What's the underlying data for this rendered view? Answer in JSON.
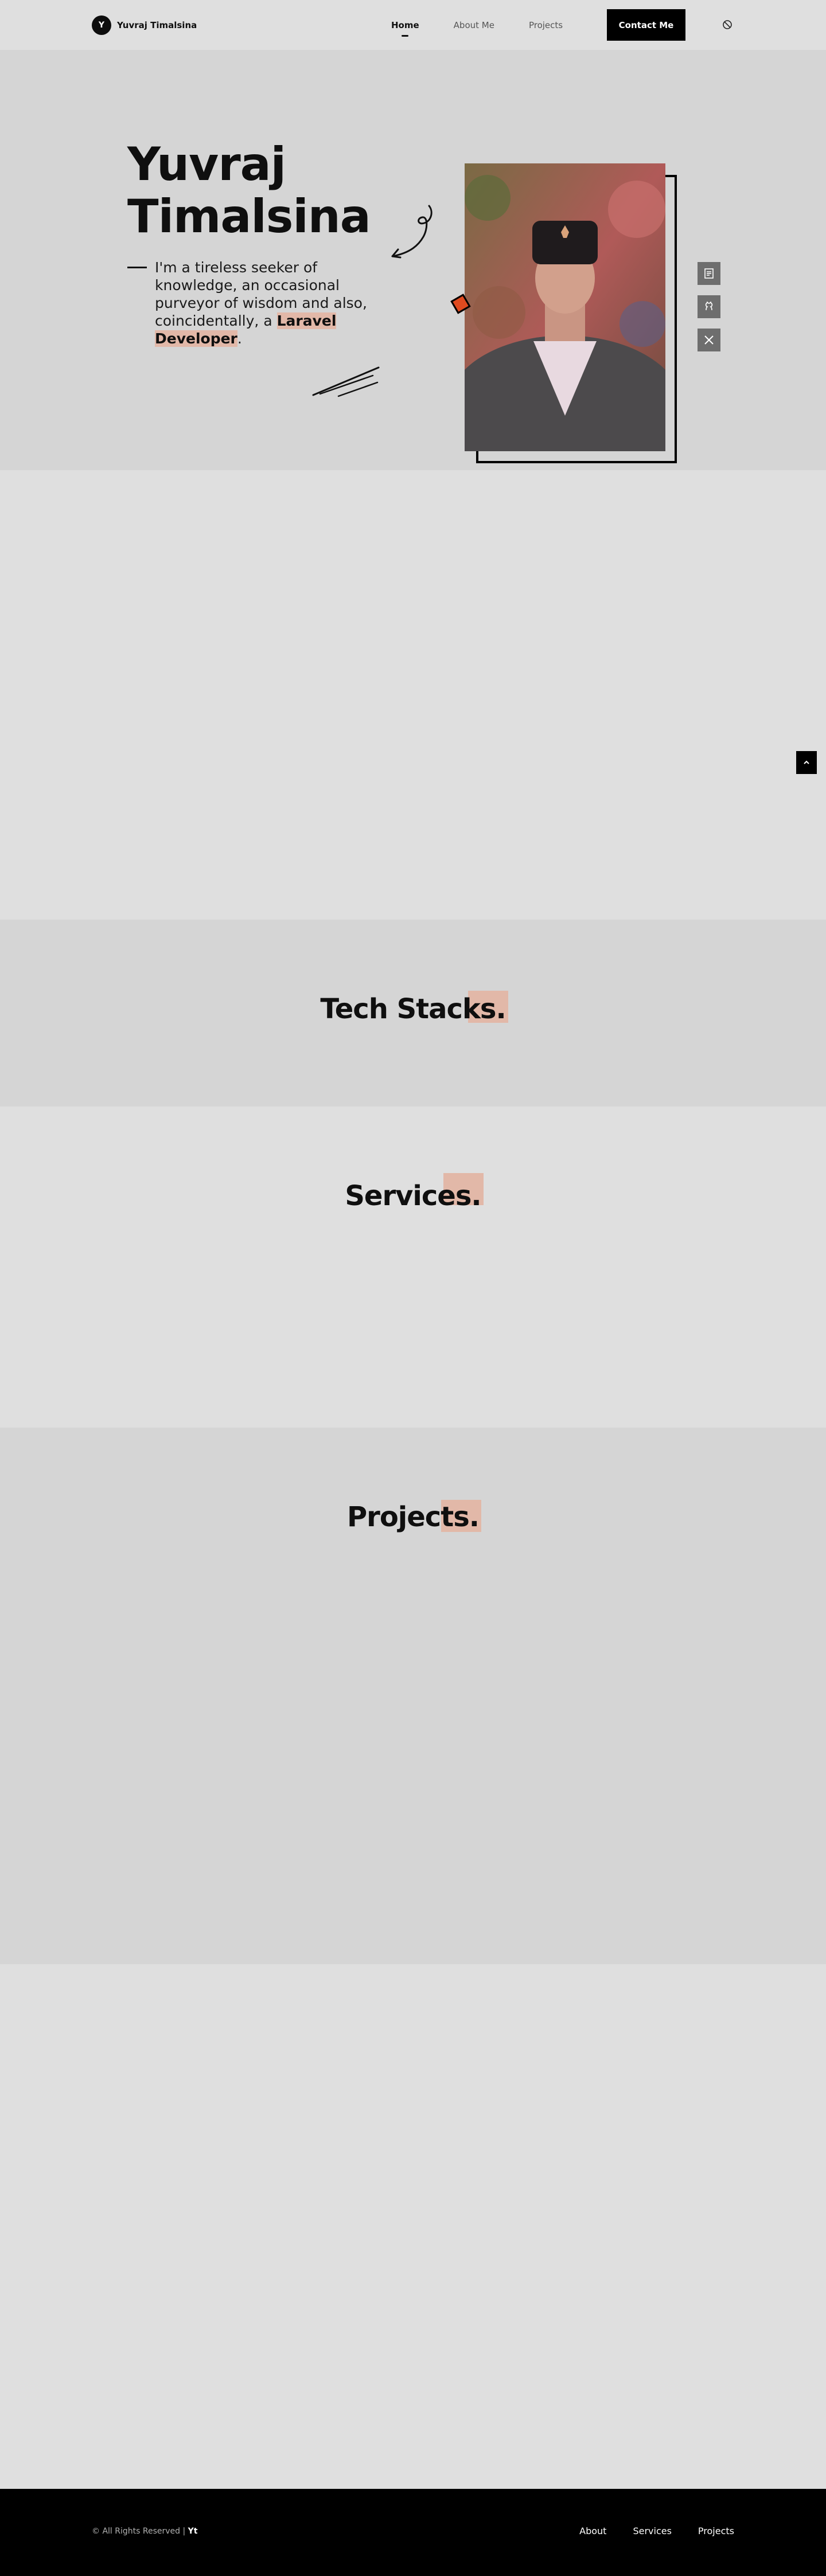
{
  "brand": {
    "logo_letter": "Y",
    "name": "Yuvraj Timalsina"
  },
  "nav": {
    "links": [
      "Home",
      "About Me",
      "Projects"
    ],
    "active": "Home",
    "contact_label": "Contact Me",
    "theme_icon": "theme-toggle-icon"
  },
  "hero": {
    "title_line1": "Yuvraj",
    "title_line2": "Timalsina",
    "desc_part1": "I'm a tireless seeker of knowledge, an occasional purveyor of wisdom and also, coincidentally, a ",
    "desc_highlight": "Laravel Developer",
    "desc_end": ".",
    "social_icons": [
      "resume-icon",
      "github-icon",
      "x-icon"
    ]
  },
  "sections": {
    "tech_title": "Tech Stacks.",
    "services_title": "Services.",
    "projects_title": "Projects."
  },
  "footer": {
    "copyright": "© All Rights Reserved | ",
    "copyright_mark": "Yt",
    "links": [
      "About",
      "Services",
      "Projects"
    ]
  },
  "colors": {
    "accent_highlight": "#e2b8a8",
    "diamond": "#e04a1f",
    "background": "#dfdfdf",
    "section_alt": "#d5d5d5"
  }
}
